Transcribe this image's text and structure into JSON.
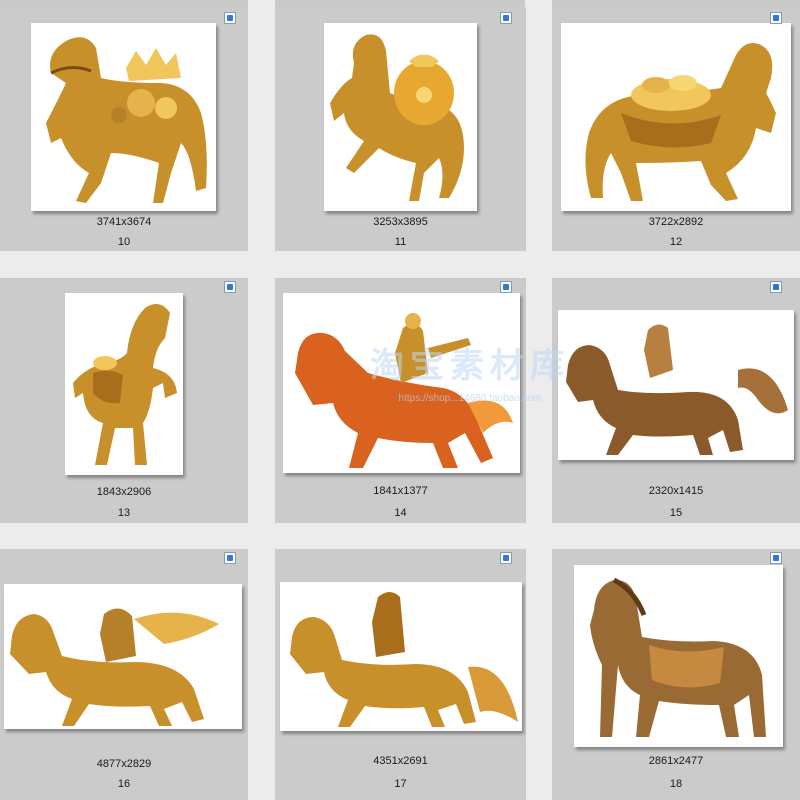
{
  "thumbnails": [
    {
      "dims": "3741x3674",
      "num": "10",
      "icon": "image-file-icon"
    },
    {
      "dims": "3253x3895",
      "num": "11",
      "icon": "image-file-icon"
    },
    {
      "dims": "3722x2892",
      "num": "12",
      "icon": "image-file-icon"
    },
    {
      "dims": "1843x2906",
      "num": "13",
      "icon": "image-file-icon"
    },
    {
      "dims": "1841x1377",
      "num": "14",
      "icon": "image-file-icon"
    },
    {
      "dims": "2320x1415",
      "num": "15",
      "icon": "image-file-icon"
    },
    {
      "dims": "4877x2829",
      "num": "16",
      "icon": "image-file-icon"
    },
    {
      "dims": "4351x2691",
      "num": "17",
      "icon": "image-file-icon"
    },
    {
      "dims": "2861x2477",
      "num": "18",
      "icon": "image-file-icon"
    }
  ],
  "watermark": {
    "text": "淘宝素材库",
    "sub": "https://shop...14680.taobao.com"
  },
  "colors": {
    "gold": "#c8902a",
    "gold_light": "#f1c65a",
    "gold_dark": "#7a4a12",
    "red_gold": "#d8621e",
    "bronze": "#8a5a2b"
  }
}
